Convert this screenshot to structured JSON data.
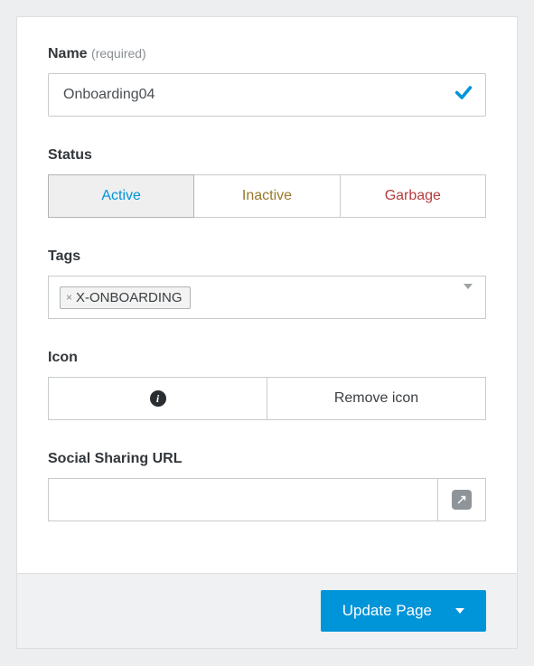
{
  "name": {
    "label": "Name",
    "required_hint": "(required)",
    "value": "Onboarding04"
  },
  "status": {
    "label": "Status",
    "options": {
      "active": "Active",
      "inactive": "Inactive",
      "garbage": "Garbage"
    },
    "selected": "active"
  },
  "tags": {
    "label": "Tags",
    "items": [
      "X-ONBOARDING"
    ]
  },
  "icon": {
    "label": "Icon",
    "remove_label": "Remove icon"
  },
  "social": {
    "label": "Social Sharing URL",
    "value": ""
  },
  "footer": {
    "update_label": "Update Page"
  }
}
